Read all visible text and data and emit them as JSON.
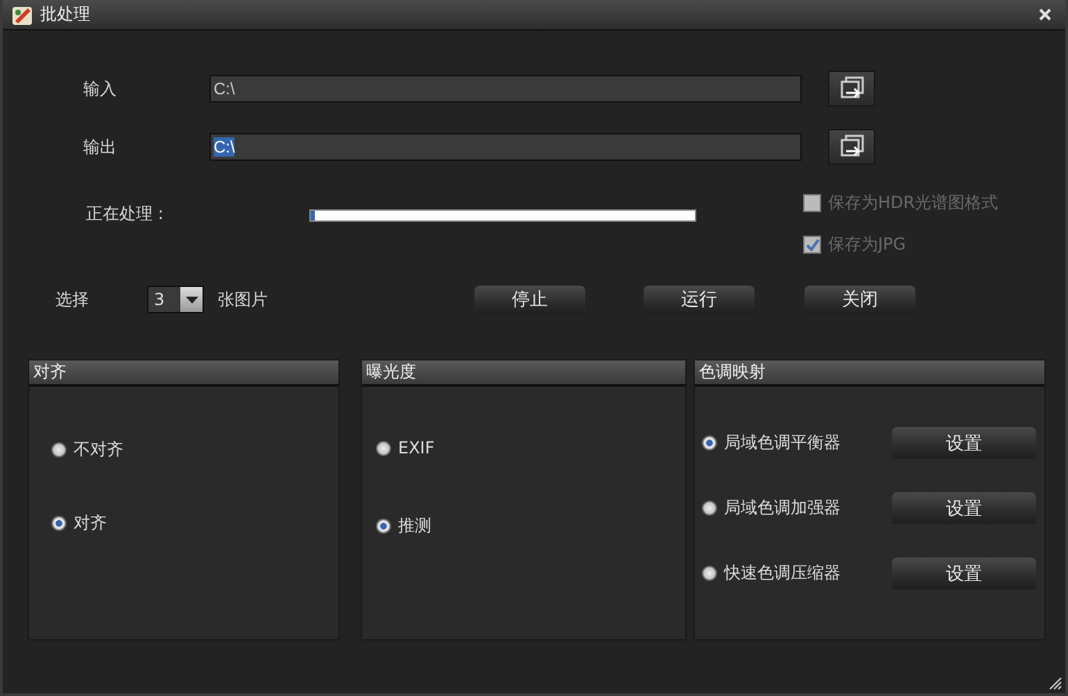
{
  "window": {
    "title": "批处理"
  },
  "input": {
    "label": "输入",
    "value": "C:\\"
  },
  "output": {
    "label": "输出",
    "value": "C:\\",
    "text_selected": true
  },
  "progress": {
    "label": "正在处理 :",
    "level": 0.01
  },
  "options": [
    {
      "label": "保存为HDR光谱图格式",
      "checked": false,
      "disabled": true
    },
    {
      "label": "保存为JPG",
      "checked": true,
      "disabled": true
    }
  ],
  "select": {
    "label": "选择",
    "value": "3",
    "suffix": "张图片"
  },
  "buttons": [
    "停止",
    "运行",
    "关闭"
  ],
  "groups": [
    {
      "title": "对齐",
      "items": [
        {
          "label": "不对齐",
          "selected": false
        },
        {
          "label": "对齐",
          "selected": true
        }
      ]
    },
    {
      "title": "曝光度",
      "items": [
        {
          "label": "EXIF",
          "selected": false
        },
        {
          "label": "推测",
          "selected": true
        }
      ]
    },
    {
      "title": "色调映射",
      "items": [
        {
          "label": "局域色调平衡器",
          "selected": true,
          "button": "设置"
        },
        {
          "label": "局域色调加强器",
          "selected": false,
          "button": "设置"
        },
        {
          "label": "快速色调压缩器",
          "selected": false,
          "button": "设置"
        }
      ]
    }
  ]
}
